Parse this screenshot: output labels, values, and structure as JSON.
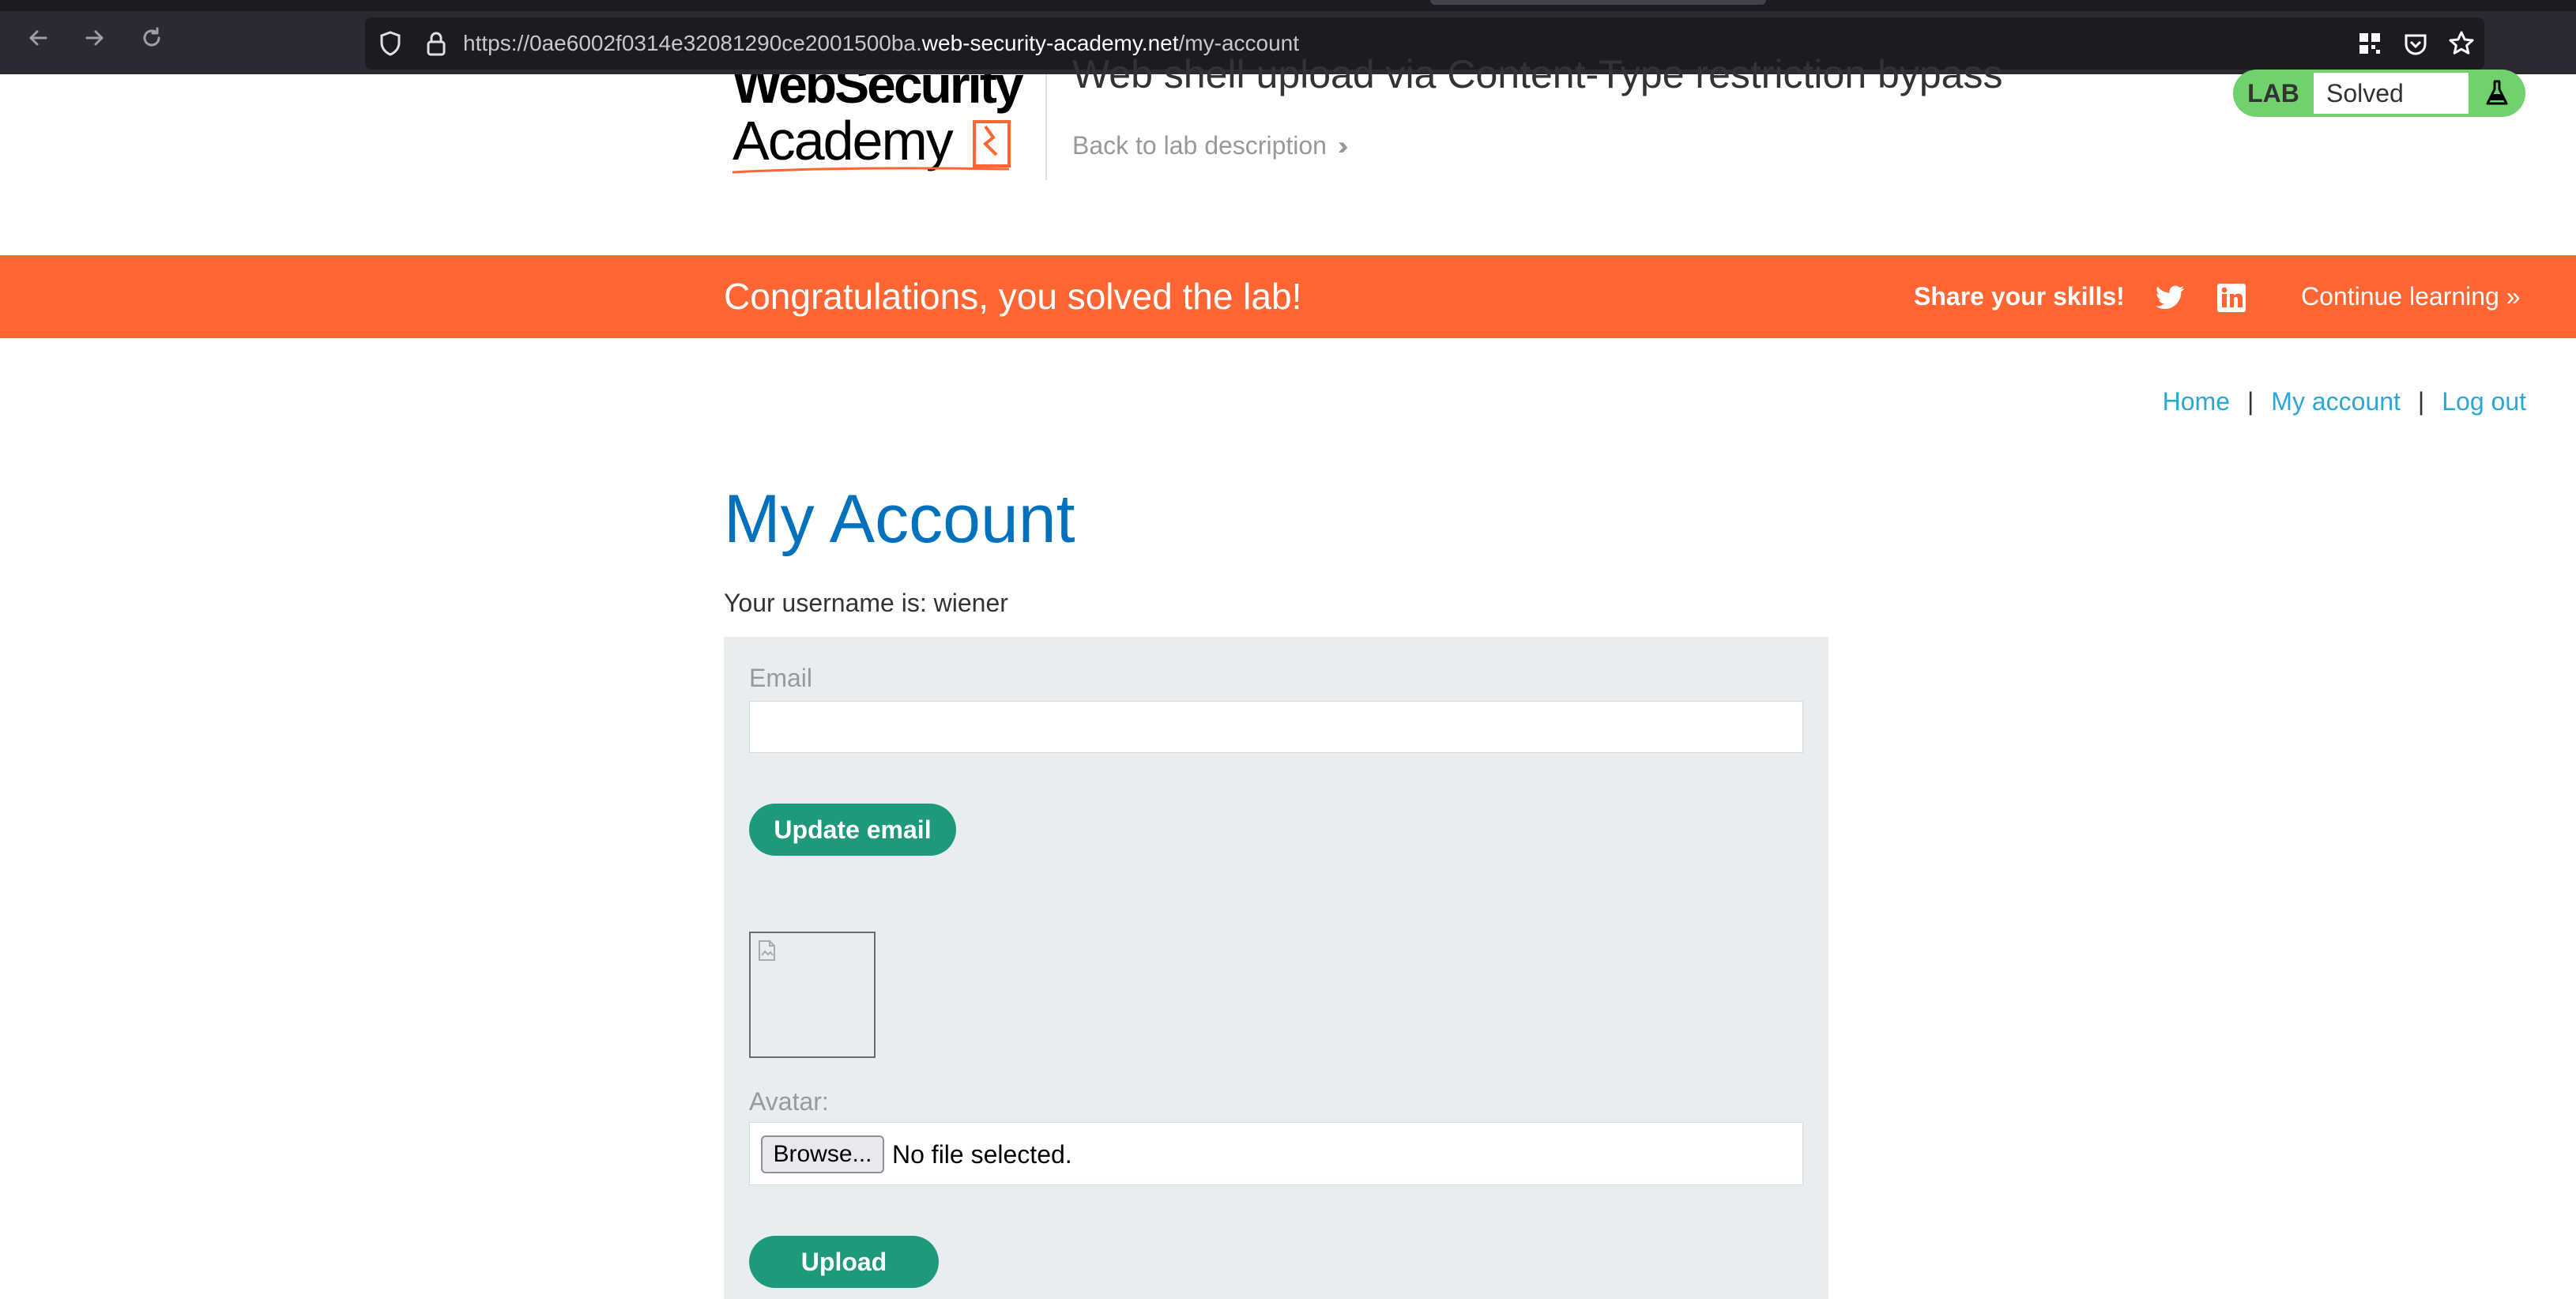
{
  "browser": {
    "url_prefix": "https://0ae6002f0314e32081290ce2001500ba.",
    "url_domain": "web-security-academy.net",
    "url_path": "/my-account"
  },
  "header": {
    "logo_line1": "WebSecurity",
    "logo_line2": "Academy",
    "lab_title": "Web shell upload via Content-Type restriction bypass",
    "back_link": "Back to lab description",
    "lab_badge": {
      "label": "LAB",
      "status": "Solved"
    }
  },
  "banner": {
    "message": "Congratulations, you solved the lab!",
    "share": "Share your skills!",
    "continue": "Continue learning"
  },
  "nav": {
    "home": "Home",
    "my_account": "My account",
    "logout": "Log out",
    "separator": "|"
  },
  "main": {
    "heading": "My Account",
    "username_text": "Your username is: wiener",
    "email_label": "Email",
    "email_value": "",
    "update_email_button": "Update email",
    "avatar_label": "Avatar:",
    "browse_button": "Browse...",
    "no_file_text": "No file selected.",
    "upload_button": "Upload"
  },
  "colors": {
    "accent_orange": "#ff6633",
    "heading_blue": "#0071bc",
    "link_blue": "#2ba6d6",
    "button_green": "#1d9a7b",
    "badge_green": "#70d16d"
  }
}
